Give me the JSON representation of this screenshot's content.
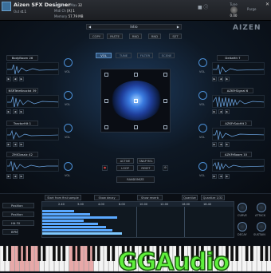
{
  "header": {
    "instrument_name": "Aizen SFX Designer",
    "output_label": "Out",
    "output_value": "st.1",
    "voices_label": "Voices",
    "voices_value": "0",
    "max_label": "Max",
    "max_value": "32",
    "midi_label": "Midi Ch",
    "midi_value": "[A] 1",
    "memory_label": "Memory",
    "memory_value": "57.79 MB",
    "tune_label": "Tune",
    "tune_value": "0.00",
    "purge_label": "Purge"
  },
  "preset": {
    "name": "Intro"
  },
  "toolbar": {
    "copy": "COPY",
    "paste": "PASTE",
    "rnd1": "RND",
    "rnd2": "RND",
    "set": "SET"
  },
  "brand_text": "AIZEN",
  "tabs": [
    {
      "label": "VOL",
      "active": true
    },
    {
      "label": "TUNE",
      "active": false
    },
    {
      "label": "FILTER",
      "active": false
    },
    {
      "label": "SCENE",
      "active": false
    }
  ],
  "layers_left": [
    {
      "name": "BodyBoom 26",
      "vol_label": "VOL"
    },
    {
      "name": "NSRTeleKnockd 39",
      "vol_label": "VOL"
    },
    {
      "name": "TractorHit 1",
      "vol_label": "VOL"
    },
    {
      "name": "ZHIClassic 42",
      "vol_label": "VOL"
    }
  ],
  "layers_right": [
    {
      "name": "DeltaHit 7",
      "vol_label": "VOL"
    },
    {
      "name": "AZKFrSignal 6",
      "vol_label": "VOL"
    },
    {
      "name": "AZKFrSubHit 2",
      "vol_label": "VOL"
    },
    {
      "name": "AZKFrBoom 10",
      "vol_label": "VOL"
    }
  ],
  "mid_buttons": {
    "active": "ACTIVE",
    "snap_rel": "SNAP REL",
    "loop": "LOOP",
    "reset": "RESET",
    "randomize": "RANDOMIZE"
  },
  "sequencer": {
    "start_from_first": "Start from first sample",
    "show_decay": "Show decay",
    "show_reverb": "Show reverb",
    "quantize": "Quantize",
    "quantize_value": "Quantize 1/32",
    "timeline": [
      "2.40",
      "3.00",
      "4.00",
      "8.00",
      "10.00",
      "12.00",
      "16.00",
      "18.40"
    ],
    "side_buttons": [
      "Position",
      "Position",
      "Hit FX",
      "BPM"
    ]
  },
  "knobs": [
    {
      "label": "CURVE"
    },
    {
      "label": "ATTACK"
    },
    {
      "label": "DECAY"
    },
    {
      "label": "SUSTAIN"
    }
  ],
  "logo_text": "GGAudio",
  "colors": {
    "accent": "#4b8fd6",
    "logo_green": "#5ff03c",
    "bar_blue": "#5aa8ff"
  }
}
